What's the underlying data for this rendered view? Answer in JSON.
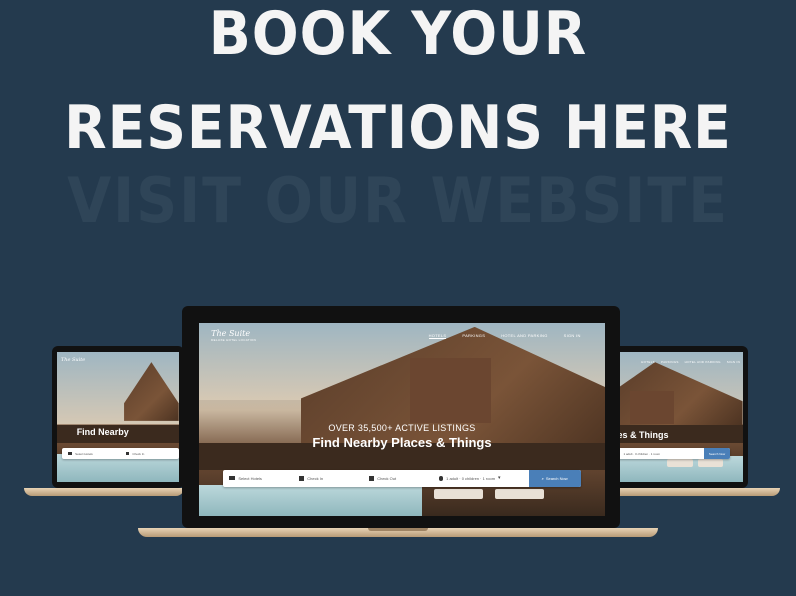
{
  "headline": {
    "line1": "BOOK YOUR",
    "line2": "RESERVATIONS HERE",
    "ghost": "VISIT OUR WEBSITE"
  },
  "website": {
    "logo_script": "The Suite",
    "logo_tagline": "DELUXE HOTEL LOCATION",
    "nav": [
      "HOTELS",
      "PARKINGS",
      "HOTEL AND PARKING",
      "SIGN IN"
    ],
    "hero_subtitle": "OVER 35,500+ ACTIVE LISTINGS",
    "hero_title": "Find Nearby Places & Things",
    "hero_title_short": "Find Nearby",
    "hero_title_right": "es & Things",
    "search": {
      "select_hotels": "Select Hotels",
      "check_in": "Check In",
      "check_out": "Check Out",
      "guests": "1 adult · 0 children · 1 room",
      "button": "Search Now"
    }
  },
  "colors": {
    "background": "#243a4e",
    "ghost_text": "#2f4558",
    "button": "#4a7fb8"
  }
}
